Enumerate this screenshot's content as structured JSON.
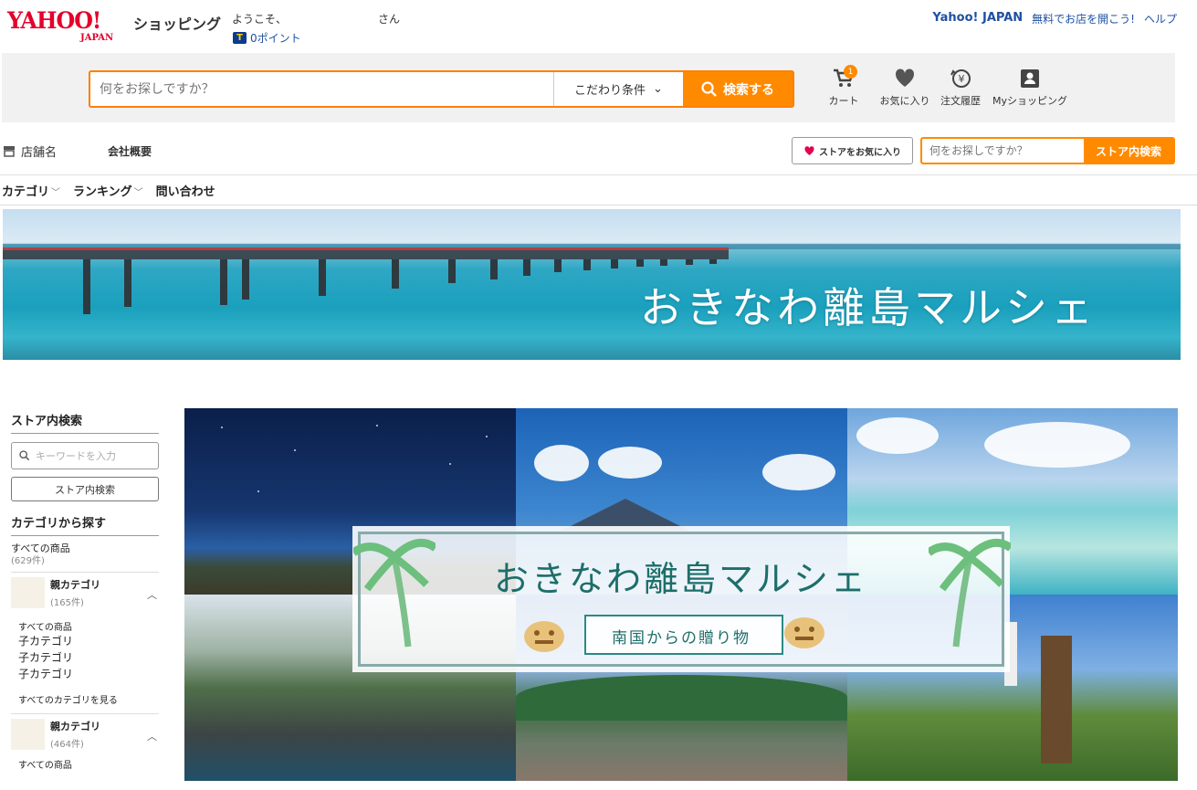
{
  "header": {
    "logo_main": "YAHOO!",
    "logo_sub": "JAPAN",
    "shop_label": "ショッピング",
    "welcome": "ようこそ、",
    "san": "さん",
    "tpoint_glyph": "T",
    "points": "0ポイント",
    "links": [
      "Yahoo! JAPAN",
      "無料でお店を開こう!",
      "ヘルプ"
    ]
  },
  "search": {
    "placeholder": "何をお探しですか？",
    "conditions_label": "こだわり条件",
    "button_label": "検索する"
  },
  "tools": [
    {
      "label": "カート",
      "icon": "cart-icon",
      "badge": "1"
    },
    {
      "label": "お気に入り",
      "icon": "heart-icon"
    },
    {
      "label": "注文履歴",
      "icon": "order-history-icon"
    },
    {
      "label": "Myショッピング",
      "icon": "my-shopping-icon"
    }
  ],
  "store_bar": {
    "store_name": "店舗名",
    "company": "会社概要",
    "fav_store": "ストアをお気に入り",
    "search_placeholder": "何をお探しですか？",
    "search_button": "ストア内検索"
  },
  "catnav": [
    "カテゴリ",
    "ランキング",
    "問い合わせ"
  ],
  "hero": {
    "title": "おきなわ離島マルシェ"
  },
  "sidebar": {
    "store_search_heading": "ストア内検索",
    "keyword_placeholder": "キーワードを入力",
    "store_search_button": "ストア内検索",
    "category_heading": "カテゴリから探す",
    "all_products": "すべての商品",
    "all_count": "(629件)",
    "parents": [
      {
        "name": "親カテゴリ",
        "count": "(165件)",
        "all": "すべての商品",
        "children": [
          "子カテゴリ",
          "子カテゴリ",
          "子カテゴリ"
        ],
        "see_all": "すべてのカテゴリを見る"
      },
      {
        "name": "親カテゴリ",
        "count": "(464件)",
        "all": "すべての商品"
      }
    ]
  },
  "collage": {
    "title": "おきなわ離島マルシェ",
    "subtitle": "南国からの贈り物"
  },
  "colors": {
    "accent": "#ff8a00",
    "brand": "#e4002b",
    "link": "#1e50a2"
  }
}
